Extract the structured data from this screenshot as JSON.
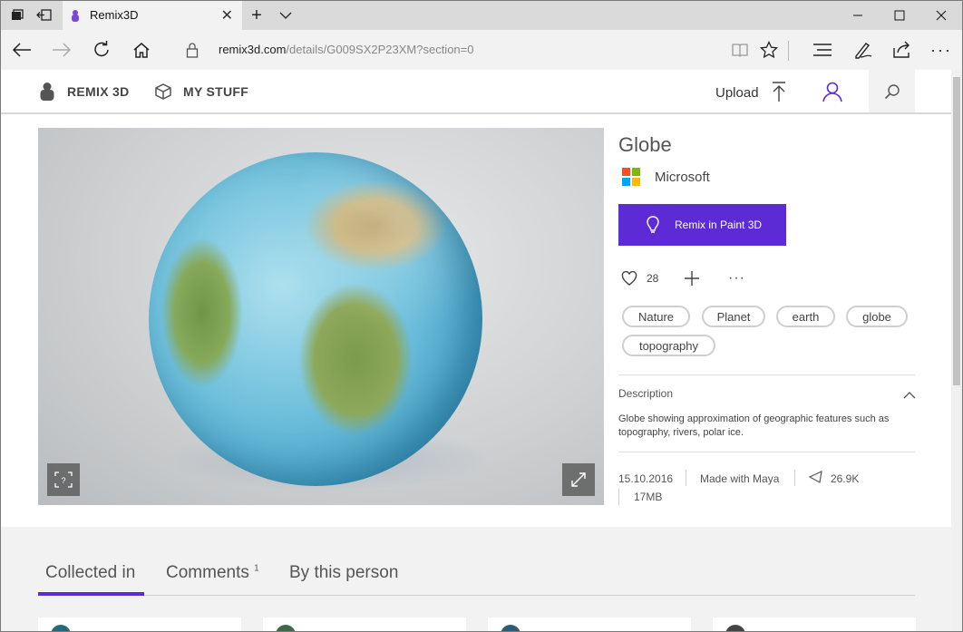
{
  "browser": {
    "tab_title": "Remix3D",
    "url_host": "remix3d.com",
    "url_path": "/details/G009SX2P23XM?section=0"
  },
  "header": {
    "brand": "REMIX 3D",
    "my_stuff": "MY STUFF",
    "upload": "Upload"
  },
  "model": {
    "title": "Globe",
    "author": "Microsoft",
    "remix_button": "Remix in Paint 3D",
    "likes": "28",
    "tags": [
      "Nature",
      "Planet",
      "earth",
      "globe",
      "topography"
    ],
    "description_title": "Description",
    "description": "Globe showing approximation of geographic features such as topography, rivers, polar ice.",
    "date": "15.10.2016",
    "made_with": "Made with Maya",
    "poly_count": "26.9K",
    "file_size": "17MB"
  },
  "lower_tabs": {
    "collected": "Collected in",
    "comments": "Comments",
    "comments_count": "1",
    "by_person": "By this person"
  },
  "colors": {
    "accent": "#5c2bd6",
    "title_bar": "#dadada",
    "toolbar": "#f2f2f2"
  }
}
